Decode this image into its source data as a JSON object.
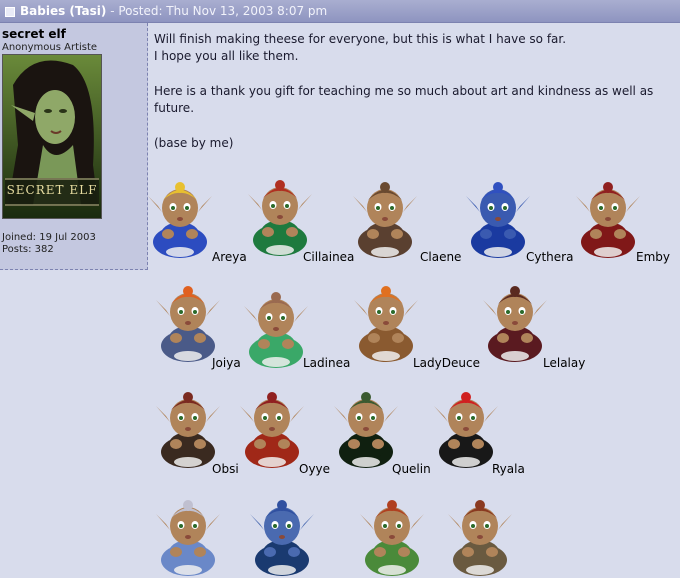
{
  "post": {
    "title": "Babies (Tasi)",
    "separator": " - ",
    "posted": "Posted: Thu Nov 13, 2003 8:07 pm"
  },
  "user": {
    "name": "secret elf",
    "rank": "Anonymous Artiste",
    "avatar_text": "SECRET ELF",
    "joined": "Joined: 19 Jul 2003",
    "posts": "Posts: 382"
  },
  "message": {
    "line1": "Will finish making theese for everyone, but this is what I have so far.",
    "line2": "I hope you all like them.",
    "line3": "Here is a thank you gift for teaching me so much about art and kindness as well as",
    "line4": "future.",
    "line5": "(base by me)"
  },
  "babies": [
    {
      "name": "Areya",
      "hair": "#e8c030",
      "outfit": "#2c4cc0",
      "skin": "#b0845a"
    },
    {
      "name": "Cillainea",
      "hair": "#b03020",
      "outfit": "#1e7a3e",
      "skin": "#b0845a"
    },
    {
      "name": "Claene",
      "hair": "#6a4a30",
      "outfit": "#5a4030",
      "skin": "#b0845a"
    },
    {
      "name": "Cythera",
      "hair": "#3050c0",
      "outfit": "#1a3aa0",
      "skin": "#3a5ab0"
    },
    {
      "name": "Emby",
      "hair": "#902020",
      "outfit": "#801818",
      "skin": "#b0845a"
    },
    {
      "name": "Joiya",
      "hair": "#e06020",
      "outfit": "#4a5a88",
      "skin": "#b0845a"
    },
    {
      "name": "Ladinea",
      "hair": "#9a6a50",
      "outfit": "#3aa868",
      "skin": "#b0845a"
    },
    {
      "name": "LadyDeuce",
      "hair": "#e07020",
      "outfit": "#8a5a30",
      "skin": "#b0845a"
    },
    {
      "name": "Lelalay",
      "hair": "#5a2a20",
      "outfit": "#5a1a20",
      "skin": "#b0845a"
    },
    {
      "name": "Obsi",
      "hair": "#7a2a20",
      "outfit": "#3a2a20",
      "skin": "#b0845a"
    },
    {
      "name": "Oyye",
      "hair": "#902020",
      "outfit": "#a02818",
      "skin": "#b0845a"
    },
    {
      "name": "Quelin",
      "hair": "#3a5a30",
      "outfit": "#102010",
      "skin": "#b0845a"
    },
    {
      "name": "Ryala",
      "hair": "#d02020",
      "outfit": "#181818",
      "skin": "#b0845a"
    },
    {
      "name": "",
      "hair": "#c0c0d0",
      "outfit": "#6a88c8",
      "skin": "#b0845a"
    },
    {
      "name": "",
      "hair": "#3050a0",
      "outfit": "#1a3a70",
      "skin": "#4a6ab0"
    },
    {
      "name": "",
      "hair": "#b04020",
      "outfit": "#4a8a3a",
      "skin": "#b0845a"
    },
    {
      "name": "",
      "hair": "#8a3a20",
      "outfit": "#6a5a40",
      "skin": "#b0845a"
    }
  ]
}
